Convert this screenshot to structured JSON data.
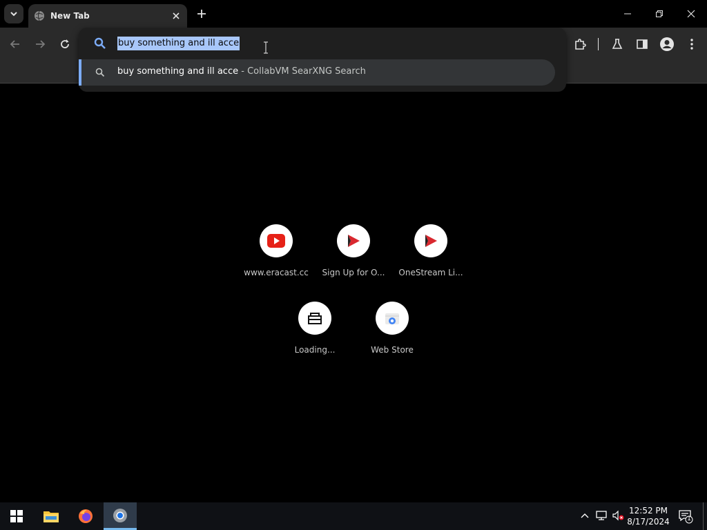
{
  "tab": {
    "title": "New Tab",
    "close_icon": "close-icon"
  },
  "window": {
    "minimize": "minimize-icon",
    "restore": "restore-icon",
    "close": "close-icon"
  },
  "omnibox": {
    "value": "buy something and ill acce",
    "suggestion": {
      "text": "buy something and ill acce",
      "separator": " - ",
      "engine": "CollabVM SearXNG Search"
    }
  },
  "shortcuts": [
    {
      "label": "www.eracast.cc",
      "icon": "youtube-icon"
    },
    {
      "label": "Sign Up for O...",
      "icon": "onestream-icon"
    },
    {
      "label": "OneStream Li...",
      "icon": "onestream-icon"
    },
    {
      "label": "Loading...",
      "icon": "store-box-icon"
    },
    {
      "label": "Web Store",
      "icon": "web-store-icon"
    }
  ],
  "taskbar": {
    "time": "12:52 PM",
    "date": "8/17/2024",
    "notification_count": "1"
  },
  "colors": {
    "accent": "#7cacf8",
    "selection": "#a8c7fa",
    "toolbar": "#2a2a2a",
    "taskbar": "#0f1115"
  }
}
